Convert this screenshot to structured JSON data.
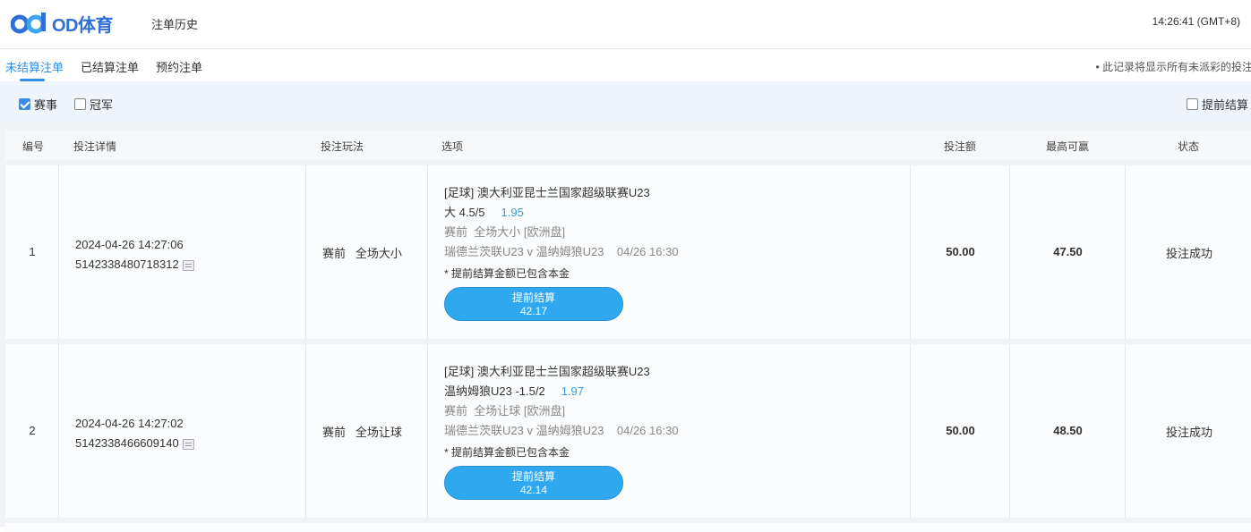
{
  "header": {
    "logo_text": "OD体育",
    "nav_history": "注单历史",
    "clock": "14:26:41 (GMT+8)"
  },
  "tabs": [
    {
      "label": "未结算注单",
      "active": true
    },
    {
      "label": "已结算注单",
      "active": false
    },
    {
      "label": "预约注单",
      "active": false
    }
  ],
  "notice": "• 此记录将显示所有未派彩的投注",
  "filters": {
    "match": {
      "label": "赛事",
      "checked": true
    },
    "champion": {
      "label": "冠军",
      "checked": false
    },
    "early_settle": {
      "label": "提前结算",
      "checked": false
    }
  },
  "columns": {
    "index": "编号",
    "detail": "投注详情",
    "play": "投注玩法",
    "option": "选项",
    "stake": "投注额",
    "max_win": "最高可赢",
    "status": "状态"
  },
  "rows": [
    {
      "index": "1",
      "datetime": "2024-04-26 14:27:06",
      "bet_id": "5142338480718312",
      "play": "赛前   全场大小",
      "league": "[足球] 澳大利亚昆士兰国家超级联赛U23",
      "selection": "大 4.5/5",
      "odds": "1.95",
      "market": "赛前  全场大小 [欧洲盘]",
      "match": "瑞德兰茨联U23 v 温纳姆狼U23    04/26 16:30",
      "early_note": "* 提前结算金额已包含本金",
      "early_label": "提前结算",
      "early_amount": "42.17",
      "stake": "50.00",
      "max_win": "47.50",
      "status": "投注成功"
    },
    {
      "index": "2",
      "datetime": "2024-04-26 14:27:02",
      "bet_id": "5142338466609140",
      "play": "赛前   全场让球",
      "league": "[足球] 澳大利亚昆士兰国家超级联赛U23",
      "selection": "温纳姆狼U23 -1.5/2",
      "odds": "1.97",
      "market": "赛前  全场让球 [欧洲盘]",
      "match": "瑞德兰茨联U23 v 温纳姆狼U23    04/26 16:30",
      "early_note": "* 提前结算金额已包含本金",
      "early_label": "提前结算",
      "early_amount": "42.14",
      "stake": "50.00",
      "max_win": "48.50",
      "status": "投注成功"
    }
  ],
  "icons": {
    "logo": "od-logo-icon",
    "copy": "copy-icon",
    "checkbox": "checkbox-icon"
  },
  "colors": {
    "accent": "#2f8fe6",
    "button": "#2fa8f0",
    "odds": "#3a9ad9",
    "filter_bg": "#eef5fd"
  }
}
